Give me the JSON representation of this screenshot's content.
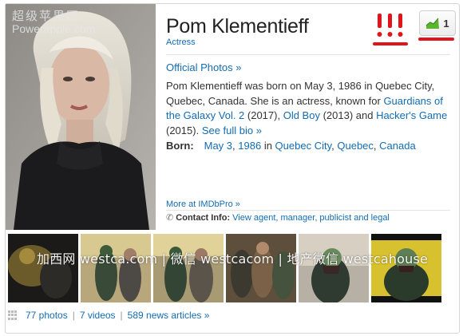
{
  "watermarks": {
    "top_cn": "超级苹果网",
    "top_en": "Powerapple.com",
    "middle": "加西网 westca.com | 微信 westcacom | 地产微信 westcahouse"
  },
  "header": {
    "name": "Pom Klementieff",
    "role": "Actress",
    "starmeter_value": "1",
    "starmeter_icon": "trend-chart-icon"
  },
  "official_photos": "Official Photos »",
  "bio": {
    "t1": "Pom Klementieff was born on May 3, 1986 in Quebec City, Quebec, Canada. She is an actress, known for ",
    "l1": "Guardians of the Galaxy Vol. 2",
    "t2": " (2017), ",
    "l2": "Old Boy",
    "t3": " (2013) and ",
    "l3": "Hacker's Game",
    "t4": " (2015). ",
    "see_full": "See full bio »"
  },
  "born": {
    "label": "Born:",
    "date": "May 3",
    "comma1": ",",
    "year": "1986",
    "in": " in ",
    "city": "Quebec City",
    "comma2": ",",
    "province": "Quebec",
    "comma3": ",",
    "country": "Canada"
  },
  "imdbpro": "More at IMDbPro »",
  "contact": {
    "icon": "phone-icon",
    "label": "Contact Info:",
    "link": "View agent, manager, publicist and legal"
  },
  "media": {
    "photos": "77 photos",
    "videos": "7 videos",
    "news": "589 news articles »",
    "sep": "|"
  },
  "colors": {
    "link": "#136cb2",
    "annotation_red": "#e1141b",
    "meter_green": "#5cb531"
  }
}
